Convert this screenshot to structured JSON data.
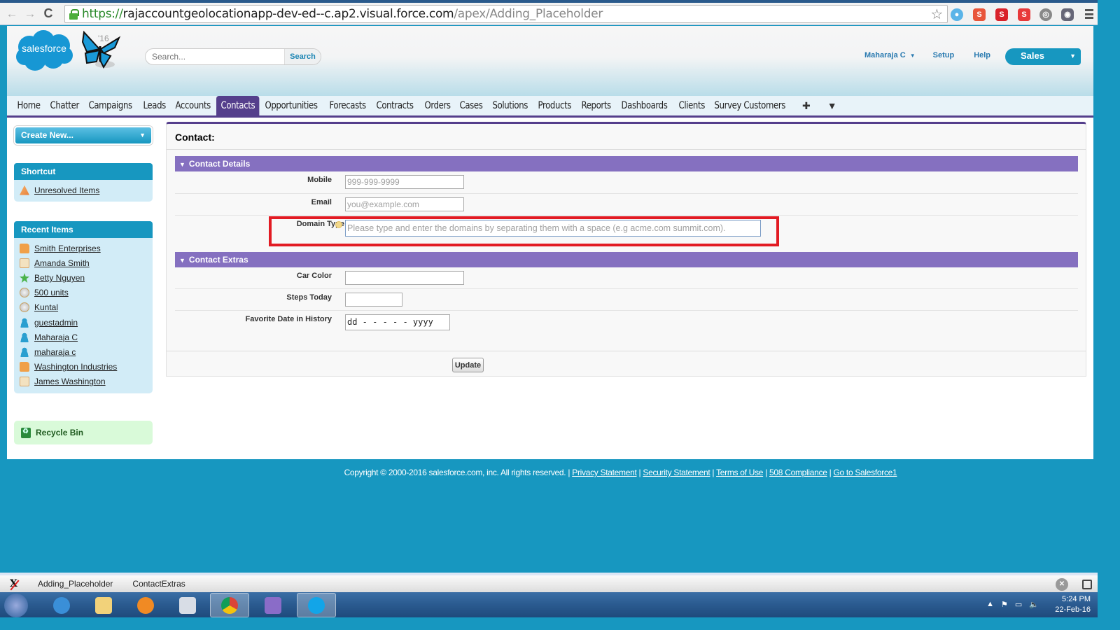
{
  "browser": {
    "url_scheme": "https://",
    "url_host": "rajaccountgeolocationapp-dev-ed--c.ap2.visual.force.com",
    "url_path": "/apex/Adding_Placeholder",
    "back_icon": "←",
    "forward_icon": "→",
    "reload_icon": "C",
    "star_icon": "☆"
  },
  "header": {
    "logo_text": "salesforce",
    "release_badge": "'16",
    "search_placeholder": "Search...",
    "search_button": "Search",
    "user_menu": "Maharaja C",
    "setup": "Setup",
    "help": "Help",
    "app_name": "Sales"
  },
  "tabs": [
    {
      "label": "Home"
    },
    {
      "label": "Chatter"
    },
    {
      "label": "Campaigns"
    },
    {
      "label": "Leads"
    },
    {
      "label": "Accounts"
    },
    {
      "label": "Contacts",
      "active": true
    },
    {
      "label": "Opportunities"
    },
    {
      "label": "Forecasts"
    },
    {
      "label": "Contracts"
    },
    {
      "label": "Orders"
    },
    {
      "label": "Cases"
    },
    {
      "label": "Solutions"
    },
    {
      "label": "Products"
    },
    {
      "label": "Reports"
    },
    {
      "label": "Dashboards"
    },
    {
      "label": "Clients"
    },
    {
      "label": "Survey Customers"
    }
  ],
  "tab_plus": "✚",
  "tab_more": "▼",
  "sidebar": {
    "create_new": "Create New...",
    "shortcut": {
      "title": "Shortcut",
      "items": [
        {
          "label": "Unresolved Items",
          "icon": "warning-icon"
        }
      ]
    },
    "recent": {
      "title": "Recent Items",
      "items": [
        {
          "label": "Smith Enterprises",
          "icon": "account-folder-icon"
        },
        {
          "label": "Amanda Smith",
          "icon": "contact-card-icon"
        },
        {
          "label": "Betty Nguyen",
          "icon": "lead-star-icon"
        },
        {
          "label": "500 units",
          "icon": "opportunity-coin-icon"
        },
        {
          "label": "Kuntal",
          "icon": "opportunity-coin-icon"
        },
        {
          "label": "guestadmin",
          "icon": "user-icon"
        },
        {
          "label": "Maharaja C",
          "icon": "user-icon"
        },
        {
          "label": "maharaja c",
          "icon": "user-icon"
        },
        {
          "label": "Washington Industries",
          "icon": "account-folder-icon"
        },
        {
          "label": "James Washington",
          "icon": "contact-card-icon"
        }
      ]
    },
    "recycle_bin": "Recycle Bin"
  },
  "main": {
    "title": "Contact:",
    "sections": [
      {
        "title": "Contact Details",
        "fields": [
          {
            "label": "Mobile",
            "value": "",
            "placeholder": "999-999-9999"
          },
          {
            "label": "Email",
            "value": "",
            "placeholder": "you@example.com"
          },
          {
            "label": "Domain Type",
            "value": "",
            "placeholder": "Please type and enter the domains by separating them with a space (e.g acme.com summit.com).",
            "has_help": true,
            "highlighted": true
          }
        ]
      },
      {
        "title": "Contact Extras",
        "fields": [
          {
            "label": "Car Color",
            "value": "",
            "placeholder": ""
          },
          {
            "label": "Steps Today",
            "value": "",
            "placeholder": ""
          },
          {
            "label": "Favorite Date in History",
            "value": "",
            "placeholder": "dd-----yyyy",
            "display": "dd - - - - - yyyy"
          }
        ]
      }
    ],
    "update_button": "Update",
    "highlight_color": "#e21b23"
  },
  "footer": {
    "copyright": "Copyright © 2000-2016 salesforce.com, inc. All rights reserved. |",
    "links": [
      "Privacy Statement",
      "Security Statement",
      "Terms of Use",
      "508 Compliance",
      "Go to Salesforce1"
    ]
  },
  "devbar": {
    "items": [
      "Adding_Placeholder",
      "ContactExtras"
    ]
  },
  "taskbar": {
    "time": "5:24 PM",
    "date": "22-Feb-16"
  },
  "colors": {
    "brand_blue": "#1797c0",
    "tab_purple": "#553f8c",
    "section_purple": "#8570c0"
  }
}
